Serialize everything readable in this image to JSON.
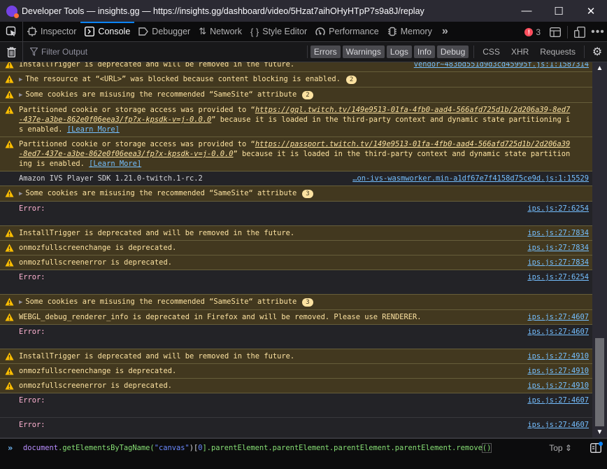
{
  "window": {
    "title": "Developer Tools — insights.gg — https://insights.gg/dashboard/video/5Hzat7aihOHyHTpP7s9a8J/replay",
    "controls": {
      "minimize": "—",
      "maximize": "☐",
      "close": "✕"
    }
  },
  "toolbox": {
    "tabs": [
      {
        "label": "Inspector",
        "icon": "inspector-icon",
        "active": false
      },
      {
        "label": "Console",
        "icon": "console-icon",
        "active": true
      },
      {
        "label": "Debugger",
        "icon": "debugger-icon",
        "active": false
      },
      {
        "label": "Network",
        "icon": "network-icon",
        "active": false
      },
      {
        "label": "Style Editor",
        "icon": "style-editor-icon",
        "active": false
      },
      {
        "label": "Performance",
        "icon": "performance-icon",
        "active": false
      },
      {
        "label": "Memory",
        "icon": "memory-icon",
        "active": false
      }
    ],
    "overflow_label": "»",
    "error_count": "3"
  },
  "filterbar": {
    "placeholder": "Filter Output",
    "levels": [
      "Errors",
      "Warnings",
      "Logs",
      "Info",
      "Debug"
    ],
    "extra": [
      "CSS",
      "XHR",
      "Requests"
    ]
  },
  "messages": [
    {
      "type": "warn",
      "text": "InstallTrigger is deprecated and will be removed in the future.",
      "location": "vendor~483bd551d9d3cd45995f.js:1:1587314"
    },
    {
      "type": "warn",
      "expandable": true,
      "text": "The resource at “<URL>” was blocked because content blocking is enabled.",
      "count": "2"
    },
    {
      "type": "warn",
      "expandable": true,
      "text": "Some cookies are misusing the recommended “SameSite“ attribute",
      "count": "2"
    },
    {
      "type": "warn",
      "prefix": "Partitioned cookie or storage access was provided to “",
      "url": "https://gql.twitch.tv/149e9513-01fa-4fb0-aad4-566afd725d1b/2d206a39-8ed7-437e-a3be-862e0f06eea3/fp?x-kpsdk-v=j-0.0.0",
      "suffix": "” because it is loaded in the third-party context and dynamic state partitioning is enabled. ",
      "learn_more": "[Learn More]"
    },
    {
      "type": "warn",
      "prefix": "Partitioned cookie or storage access was provided to “",
      "url": "https://passport.twitch.tv/149e9513-01fa-4fb0-aad4-566afd725d1b/2d206a39-8ed7-437e-a3be-862e0f06eea3/fp?x-kpsdk-v=j-0.0.0",
      "suffix": "” because it is loaded in the third-party context and dynamic state partitioning is enabled. ",
      "learn_more": "[Learn More]"
    },
    {
      "type": "log",
      "text": "Amazon IVS Player SDK 1.21.0-twitch.1-rc.2",
      "location": "…on-ivs-wasmworker.min-a1df67e7f4158d75ce9d.js:1:15529"
    },
    {
      "type": "warn",
      "expandable": true,
      "text": "Some cookies are misusing the recommended “SameSite“ attribute",
      "count": "3"
    },
    {
      "type": "error",
      "text": "Error:",
      "location": "ips.js:27:6254"
    },
    {
      "type": "warn",
      "text": "InstallTrigger is deprecated and will be removed in the future.",
      "location": "ips.js:27:7834"
    },
    {
      "type": "warn",
      "text": "onmozfullscreenchange is deprecated.",
      "location": "ips.js:27:7834"
    },
    {
      "type": "warn",
      "text": "onmozfullscreenerror is deprecated.",
      "location": "ips.js:27:7834"
    },
    {
      "type": "error",
      "text": "Error:",
      "location": "ips.js:27:6254"
    },
    {
      "type": "warn",
      "expandable": true,
      "text": "Some cookies are misusing the recommended “SameSite“ attribute",
      "count": "3"
    },
    {
      "type": "warn",
      "text": "WEBGL_debug_renderer_info is deprecated in Firefox and will be removed. Please use RENDERER.",
      "location": "ips.js:27:4607"
    },
    {
      "type": "error",
      "text": "Error:",
      "location": "ips.js:27:4607"
    },
    {
      "type": "warn",
      "text": "InstallTrigger is deprecated and will be removed in the future.",
      "location": "ips.js:27:4910"
    },
    {
      "type": "warn",
      "text": "onmozfullscreenchange is deprecated.",
      "location": "ips.js:27:4910"
    },
    {
      "type": "warn",
      "text": "onmozfullscreenerror is deprecated.",
      "location": "ips.js:27:4910"
    },
    {
      "type": "error",
      "text": "Error:",
      "location": "ips.js:27:4607"
    },
    {
      "type": "error",
      "text": "Error:",
      "location": "ips.js:27:4607"
    }
  ],
  "input": {
    "prompt": "»",
    "code": {
      "obj": "document",
      "method": ".getElementsByTagName(",
      "arg": "\"canvas\"",
      "close": ")[",
      "index": "0",
      "rest": "].parentElement.parentElement.parentElement.parentElement.remove",
      "parens": "()"
    },
    "context": "Top ⇕"
  }
}
